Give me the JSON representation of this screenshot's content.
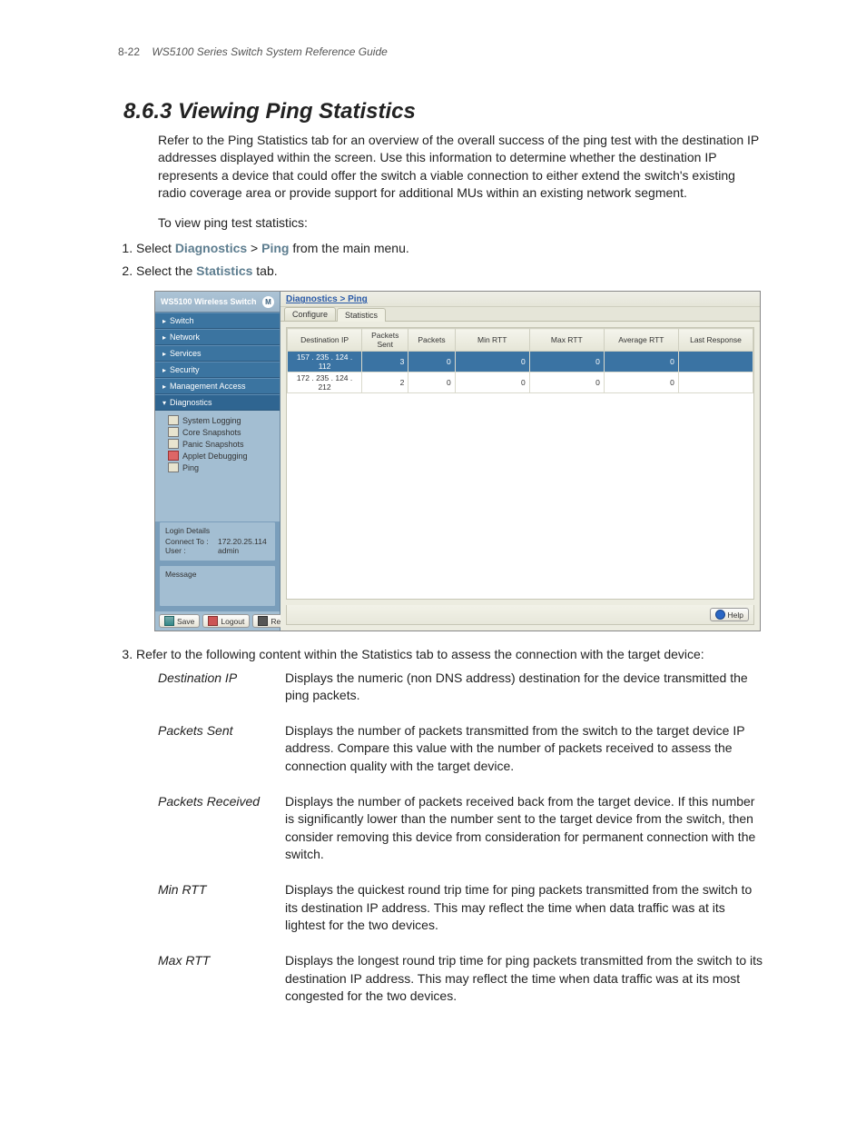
{
  "header": {
    "page": "8-22",
    "doc_title": "WS5100 Series Switch System Reference Guide"
  },
  "title": "8.6.3  Viewing Ping Statistics",
  "intro": "Refer to the Ping Statistics tab for an overview of the overall success of the ping test with the destination IP addresses displayed within the screen. Use this information to determine whether the destination IP represents a device that could offer the switch a viable connection to either extend the switch's existing radio coverage area or provide support for additional MUs within an existing network segment.",
  "lead": "To view ping test statistics:",
  "steps": {
    "s1_pre": "Select ",
    "s1_kw1": "Diagnostics",
    "s1_sep": " > ",
    "s1_kw2": "Ping",
    "s1_post": " from the main menu.",
    "s2_pre": "Select the ",
    "s2_kw": "Statistics",
    "s2_post": " tab."
  },
  "shot": {
    "brand": "WS5100 Wireless Switch",
    "logo": "M",
    "nav": {
      "switch": "Switch",
      "network": "Network",
      "services": "Services",
      "security": "Security",
      "mgmt": "Management Access",
      "diag": "Diagnostics",
      "sub": {
        "syslog": "System Logging",
        "core": "Core Snapshots",
        "panic": "Panic Snapshots",
        "applet": "Applet Debugging",
        "ping": "Ping"
      }
    },
    "login_legend": "Login Details",
    "login": {
      "k1": "Connect To :",
      "v1": "172.20.25.114",
      "k2": "User :",
      "v2": "admin"
    },
    "msg_legend": "Message",
    "buttons": {
      "save": "Save",
      "logout": "Logout",
      "refresh": "Refresh",
      "help": "Help"
    },
    "breadcrumb": "Diagnostics > Ping",
    "tabs": {
      "configure": "Configure",
      "statistics": "Statistics"
    },
    "columns": {
      "dest": "Destination IP",
      "psent": "Packets Sent",
      "precv": "Packets",
      "minrtt": "Min RTT",
      "maxrtt": "Max RTT",
      "avgrtt": "Average RTT",
      "last": "Last Response"
    },
    "rows": [
      {
        "ip": "157 . 235 . 124 . 112",
        "sent": "3",
        "recv": "0",
        "min": "0",
        "max": "0",
        "avg": "0",
        "last": ""
      },
      {
        "ip": "172 . 235 . 124 . 212",
        "sent": "2",
        "recv": "0",
        "min": "0",
        "max": "0",
        "avg": "0",
        "last": ""
      }
    ]
  },
  "step3": "Refer to the following content within the Statistics tab to assess the connection with the target device:",
  "defs": [
    {
      "term": "Destination IP",
      "desc": "Displays the numeric (non DNS address) destination for the device transmitted the ping packets."
    },
    {
      "term": "Packets Sent",
      "desc": "Displays the number of packets transmitted from the switch to the target device IP address. Compare this value with the number of packets received to assess the connection quality with the target device."
    },
    {
      "term": "Packets Received",
      "desc": "Displays the number of packets received back from the target device. If this number is significantly lower than the number sent to the target device from the switch, then consider removing this device from consideration for permanent connection with the switch."
    },
    {
      "term": "Min RTT",
      "desc": "Displays the quickest round trip time for ping packets transmitted from the switch to its destination IP address. This may reflect the time when data traffic was at its lightest for the two devices."
    },
    {
      "term": "Max RTT",
      "desc": "Displays the longest round trip time for ping packets transmitted from the switch to its destination IP address. This may reflect the time when data traffic was at its most congested for the two devices."
    }
  ]
}
